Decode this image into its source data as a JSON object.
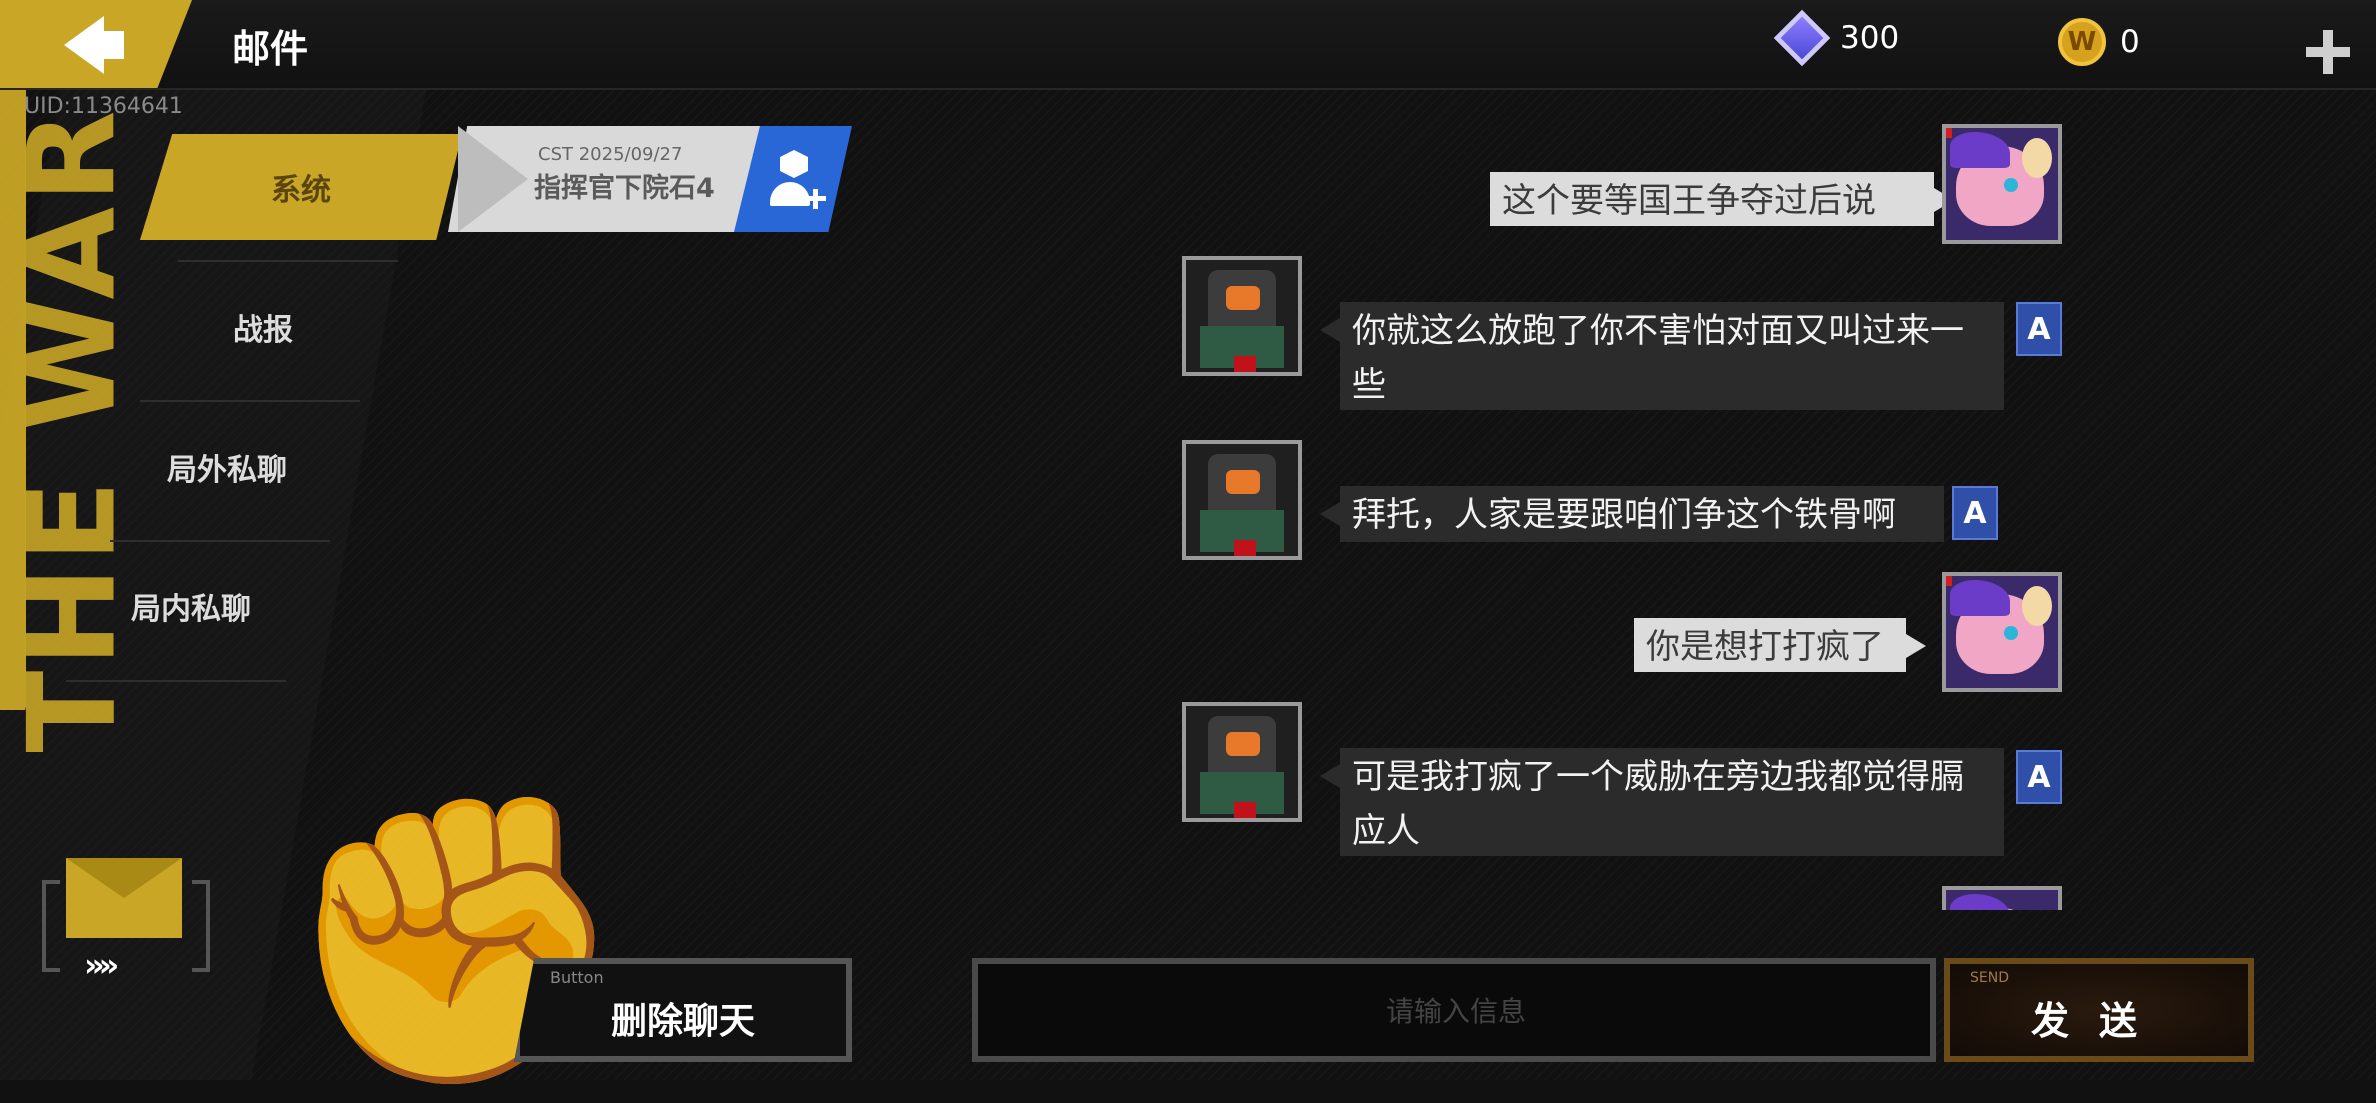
{
  "header": {
    "title": "邮件",
    "uid": "UID:11364641",
    "gems": "300",
    "coins": "0",
    "coin_letter": "W"
  },
  "decor": {
    "side_text": "THE WAR"
  },
  "tabs": [
    {
      "label": "系统",
      "active": true
    },
    {
      "label": "战报"
    },
    {
      "label": "局外私聊"
    },
    {
      "label": "局内私聊"
    }
  ],
  "contact": {
    "date": "CST 2025/09/27",
    "name": "指挥官下院石4"
  },
  "messages": [
    {
      "side": "right",
      "text": "这个要等国王争夺过后说"
    },
    {
      "side": "left",
      "text": "你就这么放跑了你不害怕对面又叫过来一些"
    },
    {
      "side": "left",
      "text": "拜托，人家是要跟咱们争这个铁骨啊"
    },
    {
      "side": "right",
      "text": "你是想打打疯了"
    },
    {
      "side": "left",
      "text": "可是我打疯了一个威胁在旁边我都觉得膈应人"
    }
  ],
  "translate_glyph": "A",
  "bottom": {
    "delete_tiny": "Button",
    "delete_label": "删除聊天",
    "input_placeholder": "请输入信息",
    "send_tiny": "SEND",
    "send_label": "发送"
  },
  "colors": {
    "accent": "#c9a626",
    "blue": "#2a67d6"
  }
}
